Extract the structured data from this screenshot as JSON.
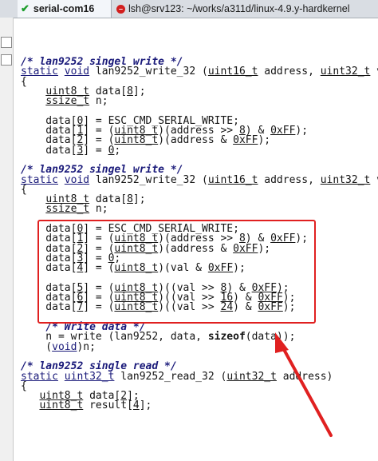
{
  "tabs": [
    {
      "label": "serial-com16",
      "active": true,
      "status": "connected",
      "icon": "check-icon"
    },
    {
      "label": "lsh@srv123: ~/works/a311d/linux-4.9.y-hardkernel",
      "active": false,
      "status": "disconnected",
      "icon": "error-icon"
    }
  ],
  "annotation": {
    "box_color": "#e02020",
    "arrow_color": "#e02020"
  },
  "code": {
    "lines": [
      [
        [
          "/* lan9252 singel write */",
          "cm"
        ]
      ],
      [
        [
          "static",
          "kw u"
        ],
        [
          " ",
          ""
        ],
        [
          "void",
          "kw u"
        ],
        [
          " lan9252_write_32 (",
          ""
        ],
        [
          "uint16_t",
          "u"
        ],
        [
          " address, ",
          ""
        ],
        [
          "uint32_t",
          "u"
        ],
        [
          " va",
          ""
        ]
      ],
      [
        [
          "{",
          ""
        ]
      ],
      [
        [
          "    ",
          ""
        ],
        [
          "uint8_t",
          "u"
        ],
        [
          " data[",
          ""
        ],
        [
          "8",
          "u"
        ],
        [
          "];",
          ""
        ]
      ],
      [
        [
          "    ",
          ""
        ],
        [
          "ssize_t",
          "u"
        ],
        [
          " n;",
          ""
        ]
      ],
      [
        [
          "",
          ""
        ]
      ],
      [
        [
          "    data[",
          ""
        ],
        [
          "0",
          "u"
        ],
        [
          "] = ESC_CMD_SERIAL_WRITE;",
          ""
        ]
      ],
      [
        [
          "    data[",
          ""
        ],
        [
          "1",
          "u"
        ],
        [
          "] = (",
          ""
        ],
        [
          "uint8_t",
          "u"
        ],
        [
          ")(address >> ",
          ""
        ],
        [
          "8",
          "u"
        ],
        [
          ") & ",
          ""
        ],
        [
          "0xFF",
          "u"
        ],
        [
          ");",
          ""
        ]
      ],
      [
        [
          "    data[",
          ""
        ],
        [
          "2",
          "u"
        ],
        [
          "] = (",
          ""
        ],
        [
          "uint8_t",
          "u"
        ],
        [
          ")(address & ",
          ""
        ],
        [
          "0xFF",
          "u"
        ],
        [
          ");",
          ""
        ]
      ],
      [
        [
          "    data[",
          ""
        ],
        [
          "3",
          "u"
        ],
        [
          "] = ",
          ""
        ],
        [
          "0",
          "u"
        ],
        [
          ";",
          ""
        ]
      ],
      [
        [
          "",
          ""
        ]
      ],
      [
        [
          "/* lan9252 singel write */",
          "cm"
        ]
      ],
      [
        [
          "static",
          "kw u"
        ],
        [
          " ",
          ""
        ],
        [
          "void",
          "kw u"
        ],
        [
          " lan9252_write_32 (",
          ""
        ],
        [
          "uint16_t",
          "u"
        ],
        [
          " address, ",
          ""
        ],
        [
          "uint32_t",
          "u"
        ],
        [
          " va",
          ""
        ]
      ],
      [
        [
          "{",
          ""
        ]
      ],
      [
        [
          "    ",
          ""
        ],
        [
          "uint8_t",
          "u"
        ],
        [
          " data[",
          ""
        ],
        [
          "8",
          "u"
        ],
        [
          "];",
          ""
        ]
      ],
      [
        [
          "    ",
          ""
        ],
        [
          "ssize_t",
          "u"
        ],
        [
          " n;",
          ""
        ]
      ],
      [
        [
          "",
          ""
        ]
      ],
      [
        [
          "    data[",
          ""
        ],
        [
          "0",
          "u"
        ],
        [
          "] = ESC_CMD_SERIAL_WRITE;",
          ""
        ]
      ],
      [
        [
          "    data[",
          ""
        ],
        [
          "1",
          "u"
        ],
        [
          "] = (",
          ""
        ],
        [
          "uint8_t",
          "u"
        ],
        [
          ")(address >> ",
          ""
        ],
        [
          "8",
          "u"
        ],
        [
          ") & ",
          ""
        ],
        [
          "0xFF",
          "u"
        ],
        [
          ");",
          ""
        ]
      ],
      [
        [
          "    data[",
          ""
        ],
        [
          "2",
          "u"
        ],
        [
          "] = (",
          ""
        ],
        [
          "uint8_t",
          "u"
        ],
        [
          ")(address & ",
          ""
        ],
        [
          "0xFF",
          "u"
        ],
        [
          ");",
          ""
        ]
      ],
      [
        [
          "    data[",
          ""
        ],
        [
          "3",
          "u"
        ],
        [
          "] = ",
          ""
        ],
        [
          "0",
          "u"
        ],
        [
          ";",
          ""
        ]
      ],
      [
        [
          "    data[",
          ""
        ],
        [
          "4",
          "u"
        ],
        [
          "] = (",
          ""
        ],
        [
          "uint8_t",
          "u"
        ],
        [
          ")(val & ",
          ""
        ],
        [
          "0xFF",
          "u"
        ],
        [
          ");",
          ""
        ]
      ],
      [
        [
          "",
          ""
        ]
      ],
      [
        [
          "    data[",
          ""
        ],
        [
          "5",
          "u"
        ],
        [
          "] = (",
          ""
        ],
        [
          "uint8_t",
          "u"
        ],
        [
          ")((val >> ",
          ""
        ],
        [
          "8",
          "u"
        ],
        [
          ") & ",
          ""
        ],
        [
          "0xFF",
          "u"
        ],
        [
          ");",
          ""
        ]
      ],
      [
        [
          "    data[",
          ""
        ],
        [
          "6",
          "u"
        ],
        [
          "] = (",
          ""
        ],
        [
          "uint8_t",
          "u"
        ],
        [
          ")((val >> ",
          ""
        ],
        [
          "16",
          "u"
        ],
        [
          ") & ",
          ""
        ],
        [
          "0xFF",
          "u"
        ],
        [
          ");",
          ""
        ]
      ],
      [
        [
          "    data[",
          ""
        ],
        [
          "7",
          "u"
        ],
        [
          "] = (",
          ""
        ],
        [
          "uint8_t",
          "u"
        ],
        [
          ")((val >> ",
          ""
        ],
        [
          "24",
          "u"
        ],
        [
          ") & ",
          ""
        ],
        [
          "0xFF",
          "u"
        ],
        [
          ");",
          ""
        ]
      ],
      [
        [
          "",
          ""
        ]
      ],
      [
        [
          "    ",
          ""
        ],
        [
          "/* Write data */",
          "cm"
        ]
      ],
      [
        [
          "    n = write (lan9252, data, ",
          ""
        ],
        [
          "sizeof",
          "b"
        ],
        [
          "(data));",
          ""
        ]
      ],
      [
        [
          "    (",
          ""
        ],
        [
          "void",
          "kw u"
        ],
        [
          ")n;",
          ""
        ]
      ],
      [
        [
          "",
          ""
        ]
      ],
      [
        [
          "/* lan9252 single read */",
          "cm"
        ]
      ],
      [
        [
          "static",
          "kw u"
        ],
        [
          " ",
          ""
        ],
        [
          "uint32_t",
          "kw u"
        ],
        [
          " lan9252_read_32 (",
          ""
        ],
        [
          "uint32_t",
          "u"
        ],
        [
          " address)",
          ""
        ]
      ],
      [
        [
          "{",
          ""
        ]
      ],
      [
        [
          "   ",
          ""
        ],
        [
          "uint8_t",
          "u"
        ],
        [
          " data[",
          ""
        ],
        [
          "2",
          "u"
        ],
        [
          "];",
          ""
        ]
      ],
      [
        [
          "   ",
          ""
        ],
        [
          "uint8_t",
          "u"
        ],
        [
          " result[",
          ""
        ],
        [
          "4",
          "u"
        ],
        [
          "];",
          ""
        ]
      ]
    ]
  }
}
